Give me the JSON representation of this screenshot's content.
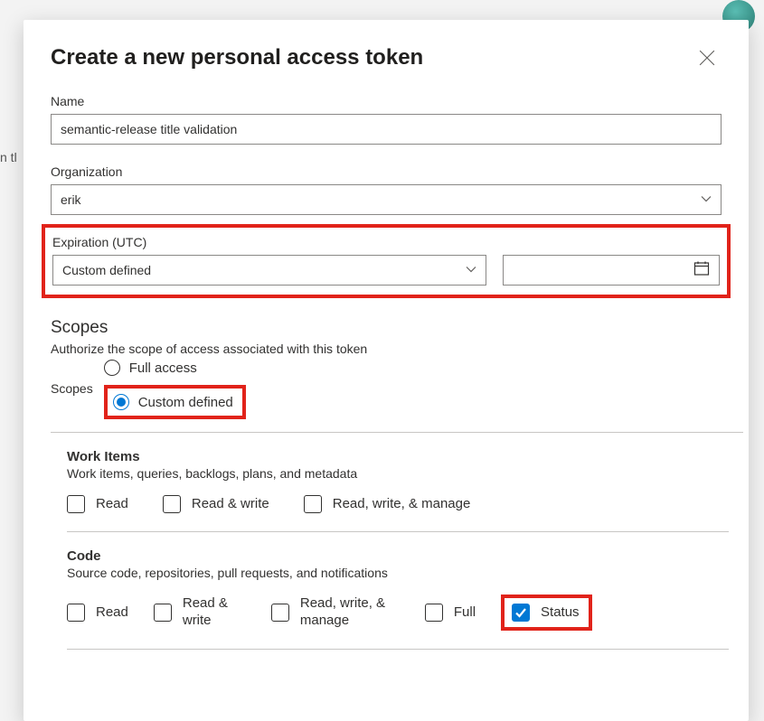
{
  "dialog": {
    "title": "Create a new personal access token"
  },
  "fields": {
    "name_label": "Name",
    "name_value": "semantic-release title validation",
    "org_label": "Organization",
    "org_value": "erik",
    "expiration_label": "Expiration (UTC)",
    "expiration_value": "Custom defined",
    "date_value": ""
  },
  "scopes": {
    "heading": "Scopes",
    "description": "Authorize the scope of access associated with this token",
    "radio_label": "Scopes",
    "options": {
      "full_access": "Full access",
      "custom_defined": "Custom defined"
    },
    "selected": "custom_defined"
  },
  "scopeGroups": [
    {
      "title": "Work Items",
      "subtitle": "Work items, queries, backlogs, plans, and metadata",
      "options": [
        {
          "label": "Read",
          "checked": false
        },
        {
          "label": "Read & write",
          "checked": false
        },
        {
          "label": "Read, write, & manage",
          "checked": false
        }
      ]
    },
    {
      "title": "Code",
      "subtitle": "Source code, repositories, pull requests, and notifications",
      "options": [
        {
          "label": "Read",
          "checked": false
        },
        {
          "label": "Read & write",
          "checked": false
        },
        {
          "label": "Read, write, & manage",
          "checked": false
        },
        {
          "label": "Full",
          "checked": false
        },
        {
          "label": "Status",
          "checked": true,
          "highlighted": true
        }
      ]
    }
  ],
  "highlights": {
    "expiration": true,
    "custom_defined": true,
    "status": true
  }
}
